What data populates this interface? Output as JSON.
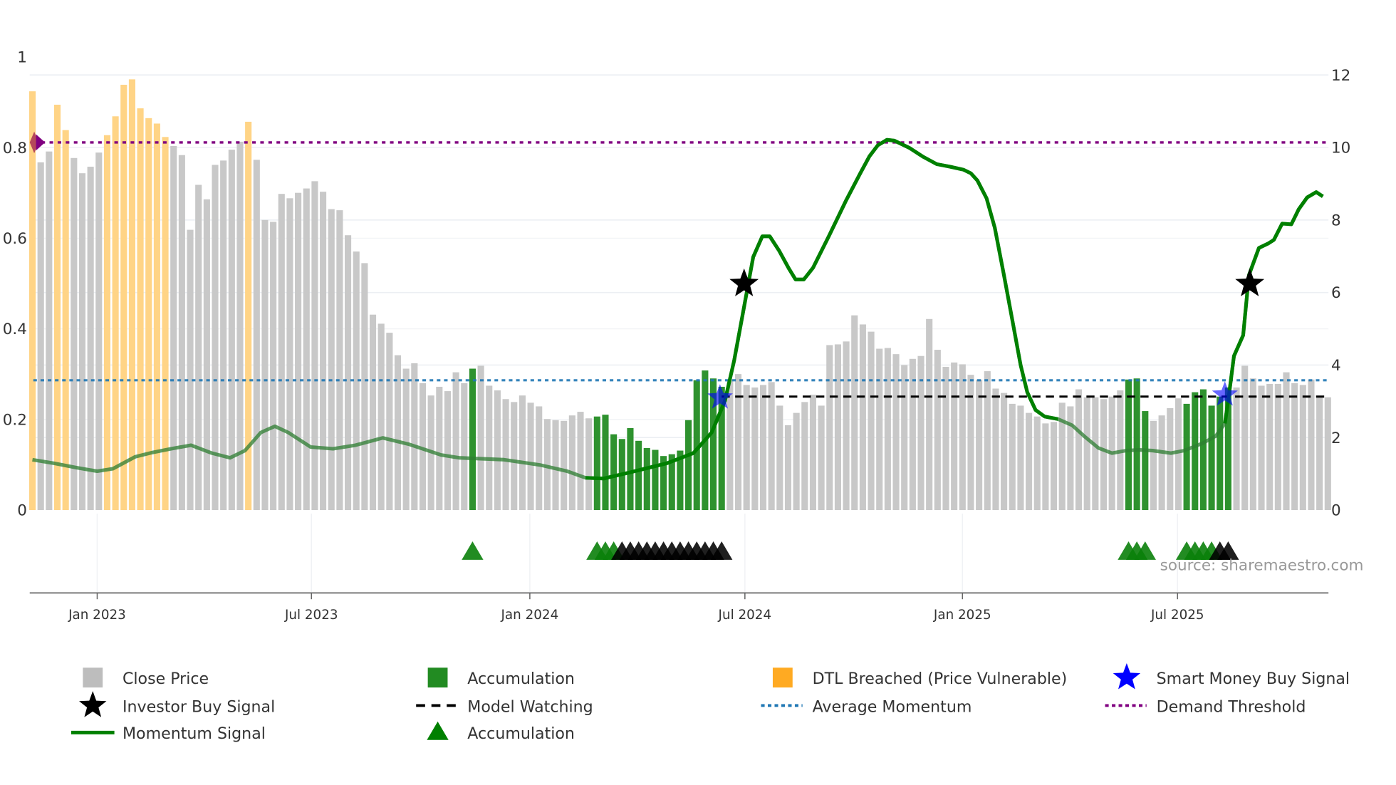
{
  "chart_data": {
    "type": "bar",
    "title": "",
    "left_axis": {
      "ticks": [
        "0",
        "0.2",
        "0.4",
        "0.6",
        "0.8",
        "1"
      ],
      "range": [
        0,
        1
      ]
    },
    "right_axis": {
      "ticks": [
        "0",
        "2",
        "4",
        "6",
        "8",
        "10",
        "12"
      ],
      "range": [
        0,
        12
      ]
    },
    "x_axis": {
      "ticks": [
        {
          "label": "Jan 2023",
          "week": 7.8
        },
        {
          "label": "Jul 2023",
          "week": 33.6
        },
        {
          "label": "Jan 2024",
          "week": 59.9
        },
        {
          "label": "Jul 2024",
          "week": 85.8
        },
        {
          "label": "Jan 2025",
          "week": 112.0
        },
        {
          "label": "Jul 2025",
          "week": 137.9
        }
      ]
    },
    "bar_type_legend": {
      "0": "Close Price",
      "1": "DTL Breached (Price Vulnerable)",
      "2": "Accumulation"
    },
    "close_price": [
      11.55,
      9.59,
      9.89,
      11.18,
      10.48,
      9.71,
      9.29,
      9.47,
      9.86,
      10.34,
      10.86,
      11.73,
      11.88,
      11.08,
      10.81,
      10.66,
      10.29,
      10.04,
      9.79,
      7.73,
      8.97,
      8.57,
      9.52,
      9.64,
      9.94,
      10.16,
      10.71,
      9.66,
      8.0,
      7.95,
      8.72,
      8.6,
      8.75,
      8.87,
      9.07,
      8.78,
      8.3,
      8.27,
      7.58,
      7.13,
      6.81,
      5.39,
      5.14,
      4.89,
      4.27,
      3.9,
      4.05,
      3.5,
      3.16,
      3.4,
      3.28,
      3.8,
      3.5,
      3.9,
      3.98,
      3.43,
      3.3,
      3.06,
      2.98,
      3.16,
      2.96,
      2.86,
      2.51,
      2.48,
      2.46,
      2.61,
      2.71,
      2.53,
      2.58,
      2.63,
      2.09,
      1.96,
      2.26,
      1.91,
      1.71,
      1.66,
      1.49,
      1.54,
      1.64,
      2.48,
      3.58,
      3.85,
      3.63,
      3.4,
      3.6,
      3.75,
      3.45,
      3.38,
      3.45,
      3.53,
      2.88,
      2.34,
      2.68,
      2.98,
      3.18,
      2.88,
      4.55,
      4.57,
      4.65,
      5.37,
      5.12,
      4.92,
      4.45,
      4.47,
      4.3,
      4.0,
      4.17,
      4.25,
      5.27,
      4.42,
      3.95,
      4.07,
      4.02,
      3.73,
      3.6,
      3.83,
      3.35,
      3.23,
      2.93,
      2.88,
      2.68,
      2.58,
      2.39,
      2.43,
      2.96,
      2.86,
      3.33,
      3.11,
      3.11,
      3.06,
      3.13,
      3.3,
      3.6,
      3.63,
      2.73,
      2.46,
      2.61,
      2.81,
      3.08,
      2.93,
      3.25,
      3.33,
      2.88,
      3.13,
      3.38,
      3.38,
      3.98,
      3.63,
      3.43,
      3.48,
      3.48,
      3.8,
      3.5,
      3.45,
      3.6,
      3.13,
      3.11
    ],
    "bar_types": [
      1,
      0,
      0,
      1,
      1,
      0,
      0,
      0,
      0,
      1,
      1,
      1,
      1,
      1,
      1,
      1,
      1,
      0,
      0,
      0,
      0,
      0,
      0,
      0,
      0,
      0,
      1,
      0,
      0,
      0,
      0,
      0,
      0,
      0,
      0,
      0,
      0,
      0,
      0,
      0,
      0,
      0,
      0,
      0,
      0,
      0,
      0,
      0,
      0,
      0,
      0,
      0,
      0,
      2,
      0,
      0,
      0,
      0,
      0,
      0,
      0,
      0,
      0,
      0,
      0,
      0,
      0,
      0,
      2,
      2,
      2,
      2,
      2,
      2,
      2,
      2,
      2,
      2,
      2,
      2,
      2,
      2,
      2,
      2,
      0,
      0,
      0,
      0,
      0,
      0,
      0,
      0,
      0,
      0,
      0,
      0,
      0,
      0,
      0,
      0,
      0,
      0,
      0,
      0,
      0,
      0,
      0,
      0,
      0,
      0,
      0,
      0,
      0,
      0,
      0,
      0,
      0,
      0,
      0,
      0,
      0,
      0,
      0,
      0,
      0,
      0,
      0,
      0,
      0,
      0,
      0,
      0,
      2,
      2,
      2,
      0,
      0,
      0,
      0,
      2,
      2,
      2,
      2,
      2,
      2,
      0,
      0,
      0,
      0,
      0,
      0,
      0,
      0,
      0,
      0,
      0,
      0
    ],
    "momentum_signal": [
      [
        0,
        1.39
      ],
      [
        2.6,
        1.29
      ],
      [
        5.3,
        1.17
      ],
      [
        7.8,
        1.07
      ],
      [
        9.7,
        1.14
      ],
      [
        12.4,
        1.47
      ],
      [
        14.5,
        1.59
      ],
      [
        16.7,
        1.69
      ],
      [
        19.1,
        1.79
      ],
      [
        21.6,
        1.57
      ],
      [
        23.8,
        1.44
      ],
      [
        25.6,
        1.64
      ],
      [
        27.5,
        2.14
      ],
      [
        29.2,
        2.31
      ],
      [
        30.8,
        2.14
      ],
      [
        33.5,
        1.74
      ],
      [
        36.2,
        1.69
      ],
      [
        38.9,
        1.79
      ],
      [
        42.2,
        1.99
      ],
      [
        45.4,
        1.81
      ],
      [
        49.2,
        1.52
      ],
      [
        51.4,
        1.44
      ],
      [
        56.8,
        1.39
      ],
      [
        61.2,
        1.24
      ],
      [
        64.4,
        1.07
      ],
      [
        66.6,
        0.89
      ],
      [
        68.8,
        0.87
      ],
      [
        72.0,
        1.04
      ],
      [
        76.4,
        1.29
      ],
      [
        79.6,
        1.57
      ],
      [
        81.8,
        2.14
      ],
      [
        83.4,
        3.01
      ],
      [
        84.5,
        4.12
      ],
      [
        85.7,
        5.61
      ],
      [
        86.8,
        6.98
      ],
      [
        87.9,
        7.55
      ],
      [
        88.8,
        7.55
      ],
      [
        89.9,
        7.16
      ],
      [
        91.1,
        6.66
      ],
      [
        91.9,
        6.36
      ],
      [
        92.9,
        6.36
      ],
      [
        94.0,
        6.68
      ],
      [
        95.9,
        7.55
      ],
      [
        98.0,
        8.55
      ],
      [
        99.7,
        9.29
      ],
      [
        100.8,
        9.76
      ],
      [
        101.8,
        10.06
      ],
      [
        102.9,
        10.21
      ],
      [
        103.8,
        10.19
      ],
      [
        105.6,
        9.99
      ],
      [
        107.3,
        9.74
      ],
      [
        108.9,
        9.54
      ],
      [
        110.5,
        9.47
      ],
      [
        112.1,
        9.39
      ],
      [
        113.0,
        9.29
      ],
      [
        113.8,
        9.09
      ],
      [
        114.9,
        8.6
      ],
      [
        115.9,
        7.78
      ],
      [
        117.0,
        6.48
      ],
      [
        118.1,
        5.12
      ],
      [
        119.0,
        4.0
      ],
      [
        119.8,
        3.25
      ],
      [
        120.8,
        2.76
      ],
      [
        121.9,
        2.58
      ],
      [
        123.5,
        2.51
      ],
      [
        125.2,
        2.34
      ],
      [
        126.8,
        2.01
      ],
      [
        128.4,
        1.71
      ],
      [
        130.0,
        1.57
      ],
      [
        131.7,
        1.64
      ],
      [
        133.3,
        1.66
      ],
      [
        134.9,
        1.64
      ],
      [
        137.1,
        1.57
      ],
      [
        138.7,
        1.64
      ],
      [
        140.9,
        1.84
      ],
      [
        142.5,
        2.04
      ],
      [
        143.6,
        2.39
      ],
      [
        144.0,
        3.01
      ],
      [
        144.7,
        4.25
      ],
      [
        145.8,
        4.82
      ],
      [
        146.5,
        6.48
      ],
      [
        147.7,
        7.23
      ],
      [
        148.8,
        7.35
      ],
      [
        149.5,
        7.45
      ],
      [
        150.5,
        7.9
      ],
      [
        151.6,
        7.88
      ],
      [
        152.5,
        8.3
      ],
      [
        153.5,
        8.62
      ],
      [
        154.6,
        8.77
      ],
      [
        155.4,
        8.65
      ]
    ],
    "average_momentum": 3.58,
    "demand_threshold": 10.14,
    "model_watching": {
      "value": 3.13,
      "from_week": 83,
      "to_week": 156
    },
    "investor_buy_signals": [
      [
        85.7,
        6.24
      ],
      [
        146.6,
        6.24
      ]
    ],
    "smart_money_buy_signals": [
      [
        82.8,
        3.1
      ],
      [
        143.6,
        3.18
      ]
    ],
    "accumulation_markers": {
      "green_weeks": [
        53,
        68,
        69,
        70,
        132,
        133,
        134,
        139,
        140,
        141,
        142
      ],
      "black_weeks": [
        71,
        72,
        73,
        74,
        75,
        76,
        77,
        78,
        79,
        80,
        81,
        82,
        83,
        143,
        144
      ]
    },
    "legend": [
      {
        "label": "Close Price",
        "color": "#bdbdbd",
        "kind": "square"
      },
      {
        "label": "Accumulation",
        "color": "#228b22",
        "kind": "square"
      },
      {
        "label": "DTL Breached (Price Vulnerable)",
        "color": "#ffaa22",
        "kind": "square"
      },
      {
        "label": "Smart Money Buy Signal",
        "color": "#0000ff",
        "kind": "star"
      },
      {
        "label": "Investor Buy Signal",
        "color": "#000000",
        "kind": "star"
      },
      {
        "label": "Model Watching",
        "color": "#000000",
        "kind": "dash"
      },
      {
        "label": "Average Momentum",
        "color": "#1f77b4",
        "kind": "dot"
      },
      {
        "label": "Demand Threshold",
        "color": "#800080",
        "kind": "dot"
      },
      {
        "label": "Momentum Signal",
        "color": "#008000",
        "kind": "line"
      },
      {
        "label": "Accumulation",
        "color": "#008000",
        "kind": "triangle"
      }
    ],
    "legend_placement": "bottom",
    "source": "source: sharemaestro.com"
  }
}
